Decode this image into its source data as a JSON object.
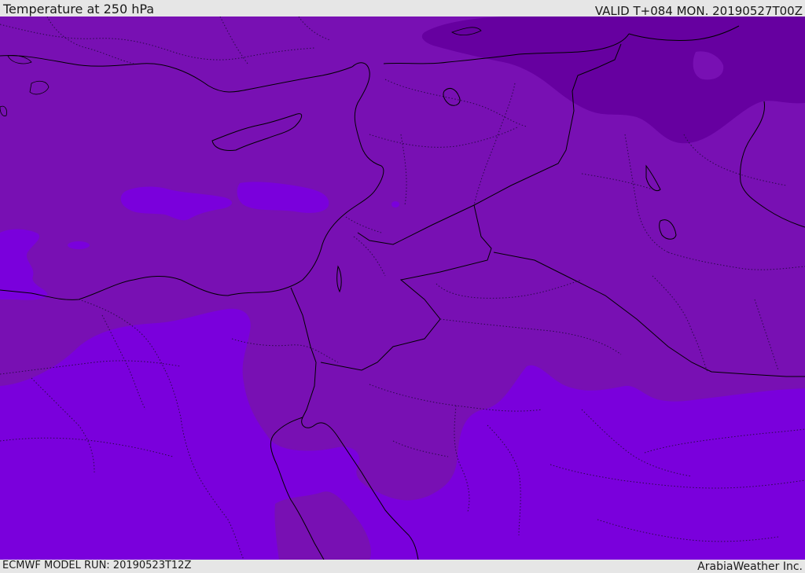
{
  "header": {
    "title": "Temperature at 250 hPa",
    "valid": "VALID T+084 MON. 20190527T00Z"
  },
  "footer": {
    "model_run": "ECMWF MODEL RUN: 20190523T12Z",
    "brand": "ArabiaWeather Inc."
  },
  "colors": {
    "band_warm": "#7a00dc",
    "band_mid": "#7810b3",
    "band_cold": "#6600a0",
    "coastline": "#000000",
    "border_dotted": "#2a0a4a",
    "frame": "#e6e6e6"
  }
}
